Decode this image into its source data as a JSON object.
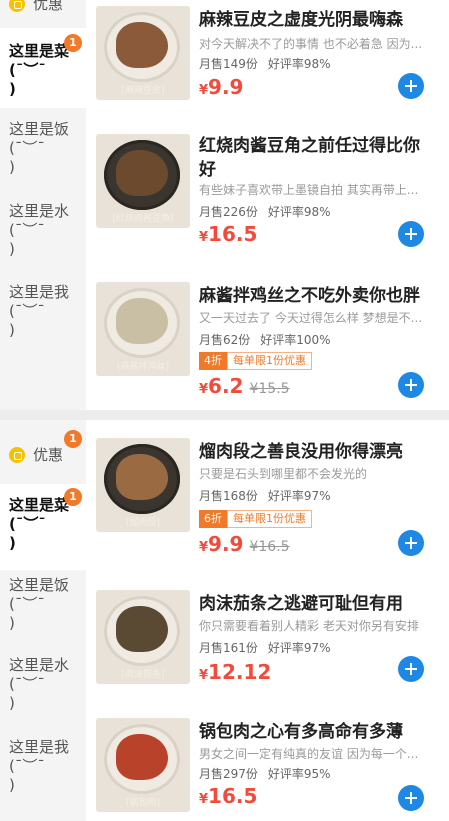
{
  "sidebar_top": {
    "promo_label": "优惠",
    "categories": [
      {
        "label": "这里是菜\n(¯︶¯\n)",
        "badge": "1",
        "active": true
      },
      {
        "label": "这里是饭\n(¯︶¯\n)",
        "active": false
      },
      {
        "label": "这里是水\n(¯︶¯\n)",
        "active": false
      },
      {
        "label": "这里是我\n(¯︶¯\n)",
        "active": false
      }
    ]
  },
  "sidebar_bottom": {
    "promo_label": "优惠",
    "promo_badge": "1",
    "categories": [
      {
        "label": "这里是菜\n(¯︶¯\n)",
        "badge": "1",
        "active": true
      },
      {
        "label": "这里是饭\n(¯︶¯\n)",
        "active": false
      },
      {
        "label": "这里是水\n(¯︶¯\n)",
        "active": false
      },
      {
        "label": "这里是我\n(¯︶¯\n)",
        "active": false
      }
    ]
  },
  "items_top": [
    {
      "title": "麻辣豆皮之虚度光阴最嗨森",
      "desc": "对今天解决不了的事情 也不必着急 因为...",
      "sold": "月售149份",
      "rating": "好评率98%",
      "currency": "¥",
      "price": "9.9",
      "caption": "[麻辣豆皮]"
    },
    {
      "title": "红烧肉酱豆角之前任过得比你好",
      "desc": "有些妹子喜欢带上墨镜自拍 其实再带上...",
      "sold": "月售226份",
      "rating": "好评率98%",
      "currency": "¥",
      "price": "16.5",
      "caption": "[红烧肉酱豆角]"
    },
    {
      "title": "麻酱拌鸡丝之不吃外卖你也胖",
      "desc": "又一天过去了 今天过得怎么样 梦想是不...",
      "sold": "月售62份",
      "rating": "好评率100%",
      "discount_rate": "4折",
      "discount_limit": "每单限1份优惠",
      "currency": "¥",
      "price": "6.2",
      "original_price": "¥15.5",
      "caption": "[麻酱拌鸡丝]"
    }
  ],
  "items_bottom": [
    {
      "title": "熘肉段之善良没用你得漂亮",
      "desc": "只要是石头到哪里都不会发光的",
      "sold": "月售168份",
      "rating": "好评率97%",
      "discount_rate": "6折",
      "discount_limit": "每单限1份优惠",
      "currency": "¥",
      "price": "9.9",
      "original_price": "¥16.5",
      "caption": "[熘肉段]"
    },
    {
      "title": "肉沫茄条之逃避可耻但有用",
      "desc": "你只需要看着别人精彩 老天对你另有安排",
      "sold": "月售161份",
      "rating": "好评率97%",
      "currency": "¥",
      "price": "12.12",
      "caption": "[肉沫茄条]"
    },
    {
      "title": "锅包肉之心有多高命有多薄",
      "desc": "男女之间一定有纯真的友谊 因为每一个...",
      "sold": "月售297份",
      "rating": "好评率95%",
      "currency": "¥",
      "price": "16.5",
      "caption": "[锅包肉]"
    }
  ],
  "colors": {
    "accent_blue": "#1e88e5",
    "price_red": "#f24b3c",
    "badge_orange": "#f07a2a",
    "promo_yellow": "#f5c200"
  },
  "icons": {
    "add": "plus-circle-icon",
    "promo": "discount-coin-icon"
  }
}
